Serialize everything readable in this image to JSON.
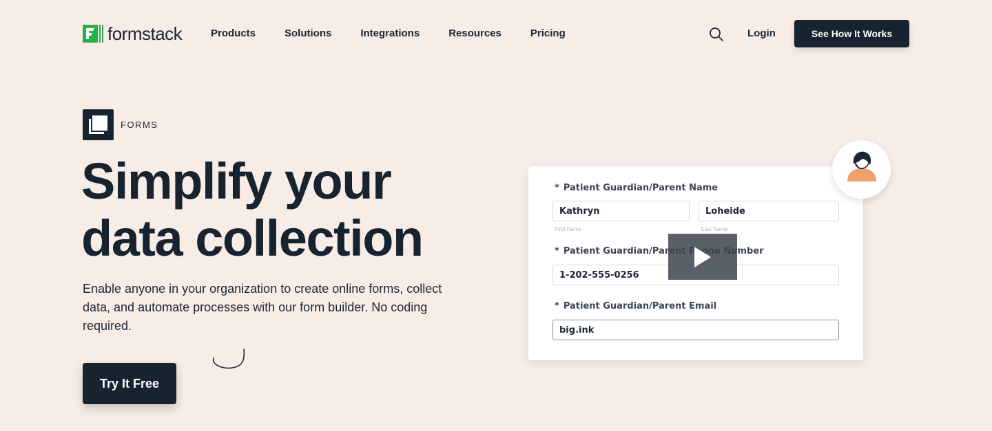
{
  "nav": {
    "brand": "formstack",
    "links": [
      "Products",
      "Solutions",
      "Integrations",
      "Resources",
      "Pricing"
    ],
    "login": "Login",
    "cta": "See How It Works",
    "search_icon": "search-icon"
  },
  "colors": {
    "background": "#f8ece6",
    "dark": "#17232e",
    "brand_green": "#21b24b",
    "avatar_orange": "#f0a06b"
  },
  "hero": {
    "badge": "FORMS",
    "headline_line1": "Simplify your",
    "headline_line2": "data collection",
    "subtext": "Enable anyone in your organization to create online forms, collect data, and automate processes with our form builder. No coding required.",
    "cta": "Try It Free"
  },
  "form_preview": {
    "name_label": "Patient Guardian/Parent Name",
    "first_name_value": "Kathryn",
    "last_name_value": "Loheide",
    "first_name_sub": "First Name",
    "last_name_sub": "Last Name",
    "phone_label": "Patient Guardian/Parent Phone Number",
    "phone_value": "1-202-555-0256",
    "email_label": "Patient Guardian/Parent Email",
    "email_value": "big.ink",
    "required_mark": "*"
  }
}
